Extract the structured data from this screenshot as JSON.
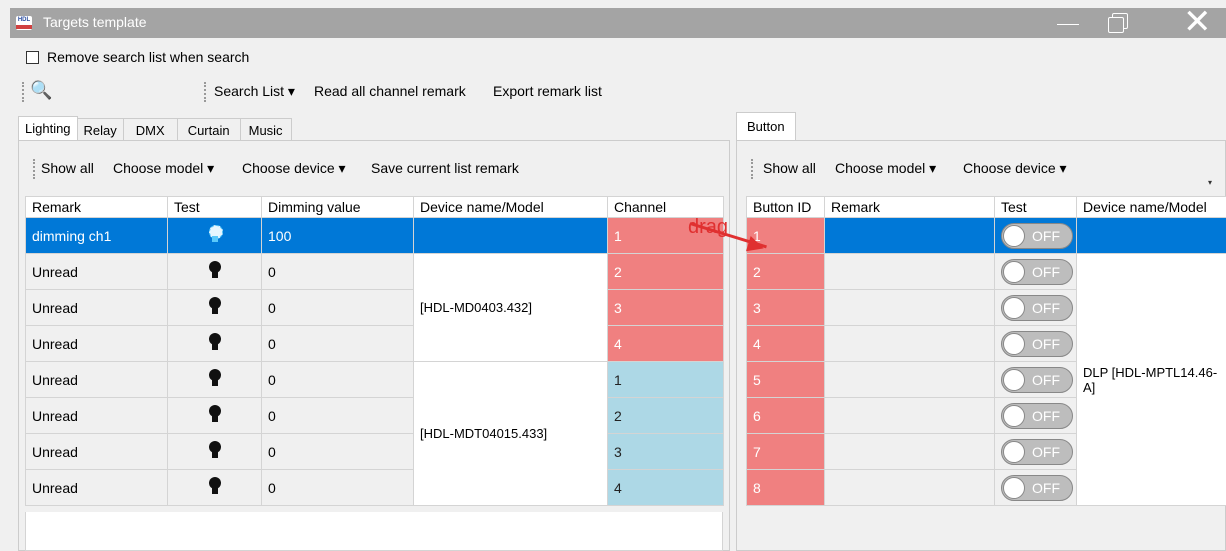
{
  "window": {
    "title": "Targets template",
    "logo": "HDL"
  },
  "top": {
    "remove_search_label": "Remove search list when search",
    "search_list": "Search List",
    "read_all": "Read all channel remark",
    "export": "Export remark list"
  },
  "left_tabs": [
    "Lighting",
    "Relay",
    "DMX",
    "Curtain",
    "Music"
  ],
  "left_toolbar": {
    "show_all": "Show all",
    "choose_model": "Choose model",
    "choose_device": "Choose device",
    "save": "Save current list remark"
  },
  "left_table": {
    "headers": [
      "Remark",
      "Test",
      "Dimming value",
      "Device name/Model",
      "Channel"
    ],
    "rows": [
      {
        "remark": "dimming ch1",
        "dimming": "100",
        "channel": "1"
      },
      {
        "remark": "Unread",
        "dimming": "0",
        "channel": "2"
      },
      {
        "remark": "Unread",
        "dimming": "0",
        "channel": "3"
      },
      {
        "remark": "Unread",
        "dimming": "0",
        "channel": "4"
      },
      {
        "remark": "Unread",
        "dimming": "0",
        "channel": "1"
      },
      {
        "remark": "Unread",
        "dimming": "0",
        "channel": "2"
      },
      {
        "remark": "Unread",
        "dimming": "0",
        "channel": "3"
      },
      {
        "remark": "Unread",
        "dimming": "0",
        "channel": "4"
      }
    ],
    "device_group1": "[HDL-MD0403.432]",
    "device_group2": "[HDL-MDT04015.433]"
  },
  "right_tab": "Button",
  "right_toolbar": {
    "show_all": "Show all",
    "choose_model": "Choose model",
    "choose_device": "Choose device"
  },
  "right_table": {
    "headers": [
      "Button ID",
      "Remark",
      "Test",
      "Device name/Model"
    ],
    "ids": [
      "1",
      "2",
      "3",
      "4",
      "5",
      "6",
      "7",
      "8"
    ],
    "toggle_label": "OFF",
    "device": "DLP [HDL-MPTL14.46-A]"
  },
  "annotation": {
    "drag": "drag"
  },
  "colors": {
    "selected": "#0078d7",
    "channel_red": "#f08080",
    "channel_blue": "#add8e6",
    "title_bar": "#a4a4a4"
  }
}
